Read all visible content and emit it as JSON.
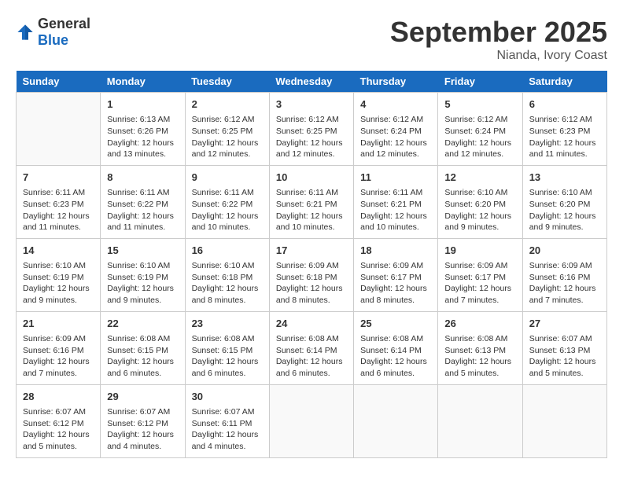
{
  "header": {
    "logo_general": "General",
    "logo_blue": "Blue",
    "title": "September 2025",
    "location": "Nianda, Ivory Coast"
  },
  "days_of_week": [
    "Sunday",
    "Monday",
    "Tuesday",
    "Wednesday",
    "Thursday",
    "Friday",
    "Saturday"
  ],
  "weeks": [
    [
      {
        "day": "",
        "sunrise": "",
        "sunset": "",
        "daylight": ""
      },
      {
        "day": "1",
        "sunrise": "Sunrise: 6:13 AM",
        "sunset": "Sunset: 6:26 PM",
        "daylight": "Daylight: 12 hours and 13 minutes."
      },
      {
        "day": "2",
        "sunrise": "Sunrise: 6:12 AM",
        "sunset": "Sunset: 6:25 PM",
        "daylight": "Daylight: 12 hours and 12 minutes."
      },
      {
        "day": "3",
        "sunrise": "Sunrise: 6:12 AM",
        "sunset": "Sunset: 6:25 PM",
        "daylight": "Daylight: 12 hours and 12 minutes."
      },
      {
        "day": "4",
        "sunrise": "Sunrise: 6:12 AM",
        "sunset": "Sunset: 6:24 PM",
        "daylight": "Daylight: 12 hours and 12 minutes."
      },
      {
        "day": "5",
        "sunrise": "Sunrise: 6:12 AM",
        "sunset": "Sunset: 6:24 PM",
        "daylight": "Daylight: 12 hours and 12 minutes."
      },
      {
        "day": "6",
        "sunrise": "Sunrise: 6:12 AM",
        "sunset": "Sunset: 6:23 PM",
        "daylight": "Daylight: 12 hours and 11 minutes."
      }
    ],
    [
      {
        "day": "7",
        "sunrise": "Sunrise: 6:11 AM",
        "sunset": "Sunset: 6:23 PM",
        "daylight": "Daylight: 12 hours and 11 minutes."
      },
      {
        "day": "8",
        "sunrise": "Sunrise: 6:11 AM",
        "sunset": "Sunset: 6:22 PM",
        "daylight": "Daylight: 12 hours and 11 minutes."
      },
      {
        "day": "9",
        "sunrise": "Sunrise: 6:11 AM",
        "sunset": "Sunset: 6:22 PM",
        "daylight": "Daylight: 12 hours and 10 minutes."
      },
      {
        "day": "10",
        "sunrise": "Sunrise: 6:11 AM",
        "sunset": "Sunset: 6:21 PM",
        "daylight": "Daylight: 12 hours and 10 minutes."
      },
      {
        "day": "11",
        "sunrise": "Sunrise: 6:11 AM",
        "sunset": "Sunset: 6:21 PM",
        "daylight": "Daylight: 12 hours and 10 minutes."
      },
      {
        "day": "12",
        "sunrise": "Sunrise: 6:10 AM",
        "sunset": "Sunset: 6:20 PM",
        "daylight": "Daylight: 12 hours and 9 minutes."
      },
      {
        "day": "13",
        "sunrise": "Sunrise: 6:10 AM",
        "sunset": "Sunset: 6:20 PM",
        "daylight": "Daylight: 12 hours and 9 minutes."
      }
    ],
    [
      {
        "day": "14",
        "sunrise": "Sunrise: 6:10 AM",
        "sunset": "Sunset: 6:19 PM",
        "daylight": "Daylight: 12 hours and 9 minutes."
      },
      {
        "day": "15",
        "sunrise": "Sunrise: 6:10 AM",
        "sunset": "Sunset: 6:19 PM",
        "daylight": "Daylight: 12 hours and 9 minutes."
      },
      {
        "day": "16",
        "sunrise": "Sunrise: 6:10 AM",
        "sunset": "Sunset: 6:18 PM",
        "daylight": "Daylight: 12 hours and 8 minutes."
      },
      {
        "day": "17",
        "sunrise": "Sunrise: 6:09 AM",
        "sunset": "Sunset: 6:18 PM",
        "daylight": "Daylight: 12 hours and 8 minutes."
      },
      {
        "day": "18",
        "sunrise": "Sunrise: 6:09 AM",
        "sunset": "Sunset: 6:17 PM",
        "daylight": "Daylight: 12 hours and 8 minutes."
      },
      {
        "day": "19",
        "sunrise": "Sunrise: 6:09 AM",
        "sunset": "Sunset: 6:17 PM",
        "daylight": "Daylight: 12 hours and 7 minutes."
      },
      {
        "day": "20",
        "sunrise": "Sunrise: 6:09 AM",
        "sunset": "Sunset: 6:16 PM",
        "daylight": "Daylight: 12 hours and 7 minutes."
      }
    ],
    [
      {
        "day": "21",
        "sunrise": "Sunrise: 6:09 AM",
        "sunset": "Sunset: 6:16 PM",
        "daylight": "Daylight: 12 hours and 7 minutes."
      },
      {
        "day": "22",
        "sunrise": "Sunrise: 6:08 AM",
        "sunset": "Sunset: 6:15 PM",
        "daylight": "Daylight: 12 hours and 6 minutes."
      },
      {
        "day": "23",
        "sunrise": "Sunrise: 6:08 AM",
        "sunset": "Sunset: 6:15 PM",
        "daylight": "Daylight: 12 hours and 6 minutes."
      },
      {
        "day": "24",
        "sunrise": "Sunrise: 6:08 AM",
        "sunset": "Sunset: 6:14 PM",
        "daylight": "Daylight: 12 hours and 6 minutes."
      },
      {
        "day": "25",
        "sunrise": "Sunrise: 6:08 AM",
        "sunset": "Sunset: 6:14 PM",
        "daylight": "Daylight: 12 hours and 6 minutes."
      },
      {
        "day": "26",
        "sunrise": "Sunrise: 6:08 AM",
        "sunset": "Sunset: 6:13 PM",
        "daylight": "Daylight: 12 hours and 5 minutes."
      },
      {
        "day": "27",
        "sunrise": "Sunrise: 6:07 AM",
        "sunset": "Sunset: 6:13 PM",
        "daylight": "Daylight: 12 hours and 5 minutes."
      }
    ],
    [
      {
        "day": "28",
        "sunrise": "Sunrise: 6:07 AM",
        "sunset": "Sunset: 6:12 PM",
        "daylight": "Daylight: 12 hours and 5 minutes."
      },
      {
        "day": "29",
        "sunrise": "Sunrise: 6:07 AM",
        "sunset": "Sunset: 6:12 PM",
        "daylight": "Daylight: 12 hours and 4 minutes."
      },
      {
        "day": "30",
        "sunrise": "Sunrise: 6:07 AM",
        "sunset": "Sunset: 6:11 PM",
        "daylight": "Daylight: 12 hours and 4 minutes."
      },
      {
        "day": "",
        "sunrise": "",
        "sunset": "",
        "daylight": ""
      },
      {
        "day": "",
        "sunrise": "",
        "sunset": "",
        "daylight": ""
      },
      {
        "day": "",
        "sunrise": "",
        "sunset": "",
        "daylight": ""
      },
      {
        "day": "",
        "sunrise": "",
        "sunset": "",
        "daylight": ""
      }
    ]
  ]
}
